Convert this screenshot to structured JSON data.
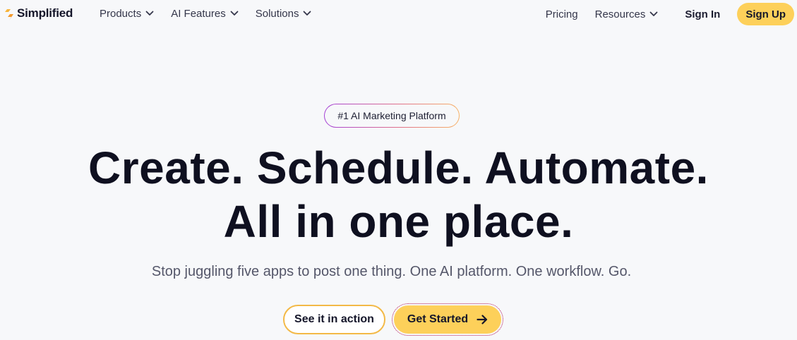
{
  "brand": {
    "name": "Simplified",
    "logo_icon": "simplified-logo-icon",
    "accent_color": "#fdd05a"
  },
  "nav": {
    "left_items": [
      {
        "label": "Products",
        "has_dropdown": true
      },
      {
        "label": "AI Features",
        "has_dropdown": true
      },
      {
        "label": "Solutions",
        "has_dropdown": true
      }
    ],
    "pricing_label": "Pricing",
    "resources_label": "Resources",
    "signin_label": "Sign In",
    "signup_label": "Sign Up"
  },
  "hero": {
    "badge": "#1 AI Marketing Platform",
    "headline_line1": "Create. Schedule. Automate.",
    "headline_line2": "All in one place.",
    "subheadline": "Stop juggling five apps to post one thing. One AI platform. One workflow. Go.",
    "cta_secondary": "See it in action",
    "cta_primary": "Get Started",
    "cta_primary_icon": "arrow-right-icon"
  }
}
